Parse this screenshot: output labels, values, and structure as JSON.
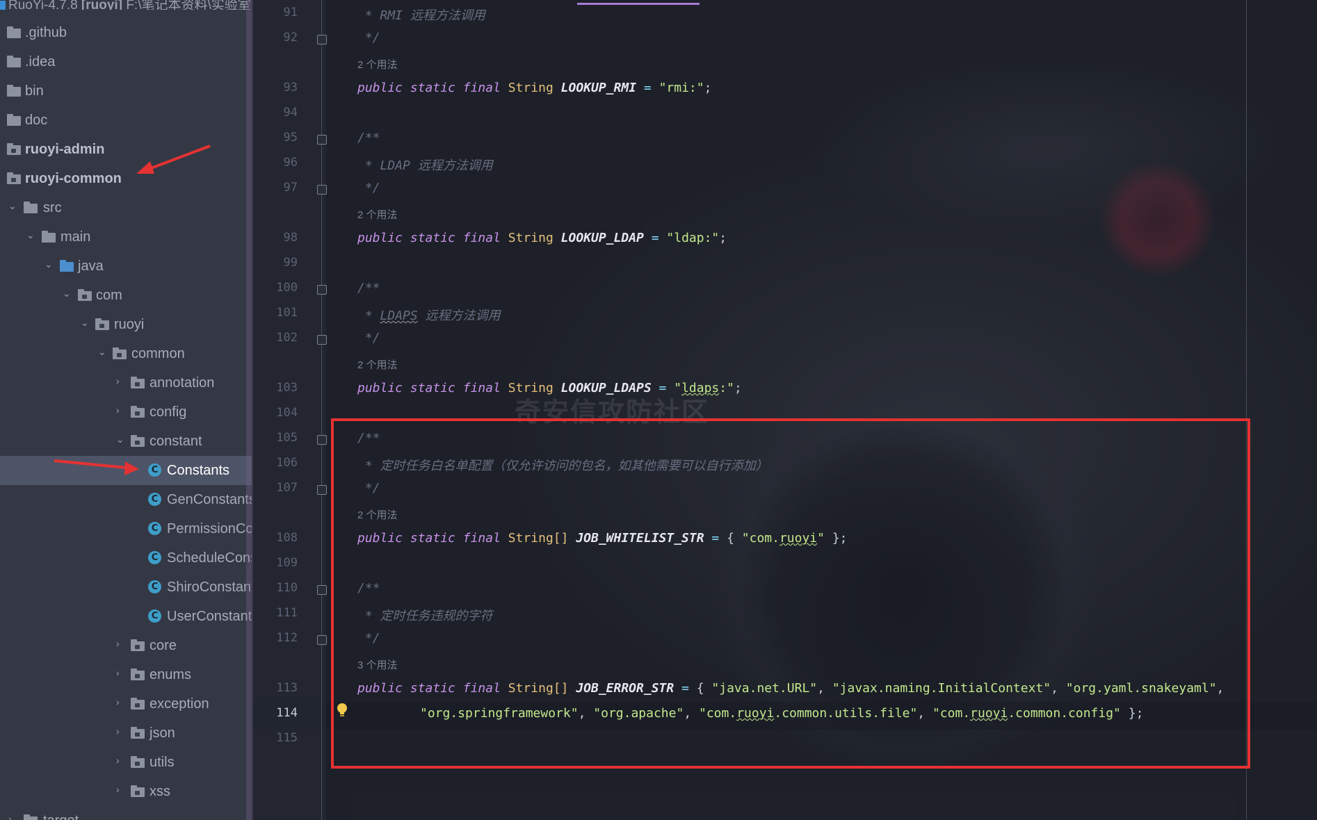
{
  "window": {
    "project_title": "RuoYi-4.7.8",
    "module_bold": "[ruoyi]",
    "path": "F:\\笔记本资料\\实验室"
  },
  "tree": {
    "items": [
      {
        "label": ".github"
      },
      {
        "label": ".idea"
      },
      {
        "label": "bin"
      },
      {
        "label": "doc"
      },
      {
        "label": "ruoyi-admin"
      },
      {
        "label": "ruoyi-common"
      },
      {
        "label": "src"
      },
      {
        "label": "main"
      },
      {
        "label": "java"
      },
      {
        "label": "com"
      },
      {
        "label": "ruoyi"
      },
      {
        "label": "common"
      },
      {
        "label": "annotation"
      },
      {
        "label": "config"
      },
      {
        "label": "constant"
      },
      {
        "label": "Constants"
      },
      {
        "label": "GenConstants"
      },
      {
        "label": "PermissionConstants"
      },
      {
        "label": "ScheduleConstants"
      },
      {
        "label": "ShiroConstants"
      },
      {
        "label": "UserConstants"
      },
      {
        "label": "core"
      },
      {
        "label": "enums"
      },
      {
        "label": "exception"
      },
      {
        "label": "json"
      },
      {
        "label": "utils"
      },
      {
        "label": "xss"
      },
      {
        "label": "target"
      }
    ],
    "class_icon_letter": "C"
  },
  "editor": {
    "line_numbers": [
      "91",
      "92",
      "93",
      "94",
      "95",
      "96",
      "97",
      "98",
      "99",
      "100",
      "101",
      "102",
      "103",
      "104",
      "105",
      "106",
      "107",
      "108",
      "109",
      "110",
      "111",
      "112",
      "113",
      "114",
      "115"
    ],
    "usage_hints": [
      "2 个用法",
      "2 个用法",
      "2 个用法",
      "2 个用法",
      "3 个用法"
    ],
    "tokens": {
      "public": "public",
      "static": "static",
      "final": "final",
      "string": "String",
      "string_arr": "String[]"
    },
    "lines": {
      "c91": " * RMI 远程方法调用",
      "c92": " */",
      "n93": "LOOKUP_RMI",
      "v93": "\"rmi:\"",
      "c95": "/**",
      "c96": " * LDAP 远程方法调用",
      "c97": " */",
      "n98": "LOOKUP_LDAP",
      "v98": "\"ldap:\"",
      "c100": "/**",
      "c101_a": " * ",
      "c101_b": "LDAPS",
      "c101_c": " 远程方法调用",
      "c102": " */",
      "n103": "LOOKUP_LDAPS",
      "v103_a": "\"",
      "v103_b": "ldaps",
      "v103_c": ":\"",
      "c105": "/**",
      "c106": " * 定时任务白名单配置（仅允许访问的包名，如其他需要可以自行添加）",
      "c107": " */",
      "n108": "JOB_WHITELIST_STR",
      "v108_a": "\"com.",
      "v108_b": "ruoyi",
      "v108_c": "\"",
      "c110": "/**",
      "c111": " * 定时任务违规的字符",
      "c112": " */",
      "n113": "JOB_ERROR_STR",
      "v113_1": "\"java.net.URL\"",
      "v113_2": "\"javax.naming.InitialContext\"",
      "v113_3": "\"org.yaml.snakeyaml\"",
      "v114_1": "\"org.springframework\"",
      "v114_2": "\"org.apache\"",
      "v114_3a": "\"com.",
      "v114_3b": "ruoyi",
      "v114_3c": ".common.utils.file\"",
      "v114_4a": "\"com.",
      "v114_4b": "ruoyi",
      "v114_4c": ".common.config\""
    }
  },
  "watermark": "奇安信攻防社区",
  "colors": {
    "annotation_red": "#e53232",
    "keyword": "#c792ea",
    "type": "#e5c07b",
    "string": "#c3e88d"
  }
}
